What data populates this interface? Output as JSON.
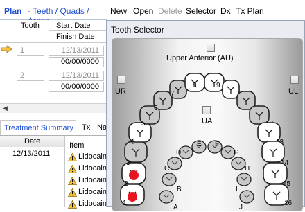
{
  "header": {
    "plan": "Plan",
    "subtitle": "- Teeth / Quads / Areas"
  },
  "toolbar": {
    "items": [
      "New",
      "Open",
      "Delete",
      "Selector",
      "Dx",
      "Tx Plan"
    ]
  },
  "grid": {
    "col_tooth": "Tooth",
    "col_start": "Start Date",
    "col_finish": "Finish Date",
    "rows": [
      {
        "tooth": "1",
        "start": "12/13/2011",
        "finish": "00/00/0000"
      },
      {
        "tooth": "2",
        "start": "12/13/2011",
        "finish": "00/00/0000"
      }
    ]
  },
  "summary": {
    "tab_active": "Treatment Summary",
    "tab_tx": "Tx",
    "tab_na": "Na",
    "col_date": "Date",
    "col_item": "Item",
    "date_value": "12/13/2011",
    "items": [
      "Lidocain",
      "Lidocain",
      "Lidocain",
      "Lidocain",
      "Lidocain"
    ]
  },
  "dialog": {
    "title": "Tooth Selector",
    "upper_anterior": "Upper Anterior (AU)",
    "ur": "UR",
    "ul": "UL",
    "ua": "UA",
    "teeth_numbers": [
      "1",
      "2",
      "3",
      "4",
      "5",
      "6",
      "7",
      "8",
      "9",
      "10",
      "11",
      "12",
      "13",
      "14",
      "15",
      "16"
    ],
    "teeth_letters": [
      "A",
      "B",
      "C",
      "D",
      "E",
      "F",
      "G",
      "H",
      "I",
      "J"
    ],
    "selected_teeth": [
      "1",
      "2"
    ]
  },
  "colors": {
    "accent": "#1f4fd0",
    "selected_mark": "#e8141e",
    "arrow": "#f5c242"
  }
}
